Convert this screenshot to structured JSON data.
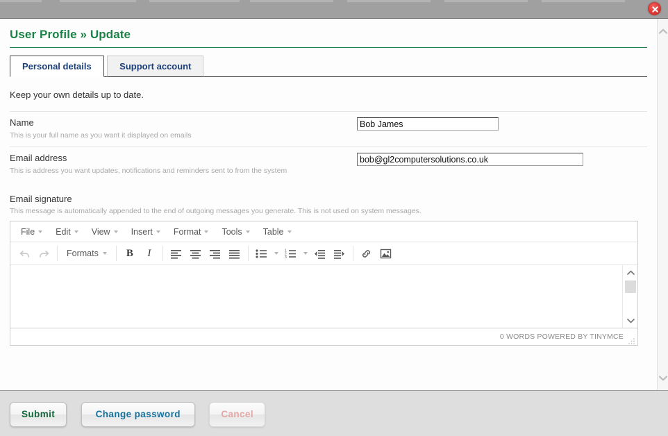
{
  "window": {
    "close_icon": "close-icon"
  },
  "header": {
    "title_main": "User Profile",
    "title_sep": "»",
    "title_sub": "Update"
  },
  "tabs": [
    {
      "label": "Personal details",
      "active": true
    },
    {
      "label": "Support account",
      "active": false
    }
  ],
  "intro": "Keep your own details up to date.",
  "fields": [
    {
      "label": "Name",
      "help": "This is your full name as you want it displayed on emails",
      "value": "Bob James",
      "placeholder": ""
    },
    {
      "label": "Email address",
      "help": "This is address you want updates, notifications and reminders sent to from the system",
      "value": "bob@gl2computersolutions.co.uk",
      "placeholder": ""
    }
  ],
  "signature": {
    "label": "Email signature",
    "help": "This message is automatically appended to the end of outgoing messages you generate. This is not used on system messages.",
    "content": "",
    "menubar": [
      "File",
      "Edit",
      "View",
      "Insert",
      "Format",
      "Tools",
      "Table"
    ],
    "toolbar": {
      "undo": "undo-icon",
      "redo": "redo-icon",
      "formats_label": "Formats",
      "bold": "B",
      "italic": "I",
      "align_left": "align-left-icon",
      "align_center": "align-center-icon",
      "align_right": "align-right-icon",
      "align_justify": "align-justify-icon",
      "bullet_list": "bullet-list-icon",
      "numbered_list": "numbered-list-icon",
      "outdent": "outdent-icon",
      "indent": "indent-icon",
      "link": "link-icon",
      "image": "image-icon"
    },
    "statusbar": "0 WORDS POWERED BY TINYMCE"
  },
  "footer": {
    "submit_label": "Submit",
    "change_password_label": "Change password",
    "cancel_label": "Cancel"
  },
  "colors": {
    "heading_green": "#1a8245",
    "tab_blue": "#1c3f77",
    "submit_green": "#14673c",
    "change_blue": "#1573a0",
    "cancel_pink": "#e3a7a7",
    "titlebar_gray": "#a0a0a0",
    "footer_gray": "#dedede"
  }
}
